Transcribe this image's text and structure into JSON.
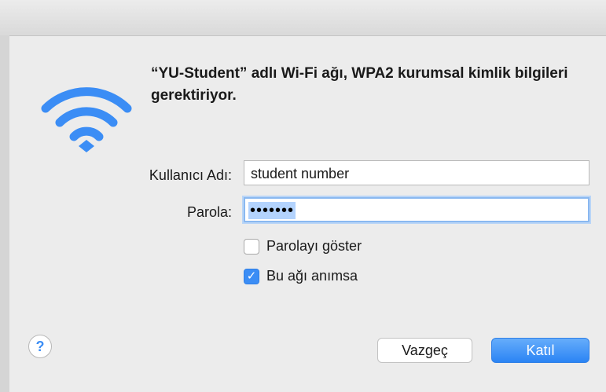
{
  "dialog": {
    "message": "“YU-Student” adlı Wi-Fi ağı, WPA2 kurumsal kimlik bilgileri gerektiriyor.",
    "icon": "wifi-icon",
    "accent_color": "#3b8df5"
  },
  "form": {
    "username_label": "Kullanıcı Adı:",
    "username_value": "student number",
    "password_label": "Parola:",
    "password_value": "•••••••",
    "show_password_label": "Parolayı göster",
    "show_password_checked": false,
    "remember_label": "Bu ağı anımsa",
    "remember_checked": true
  },
  "buttons": {
    "help": "?",
    "cancel": "Vazgeç",
    "join": "Katıl"
  }
}
